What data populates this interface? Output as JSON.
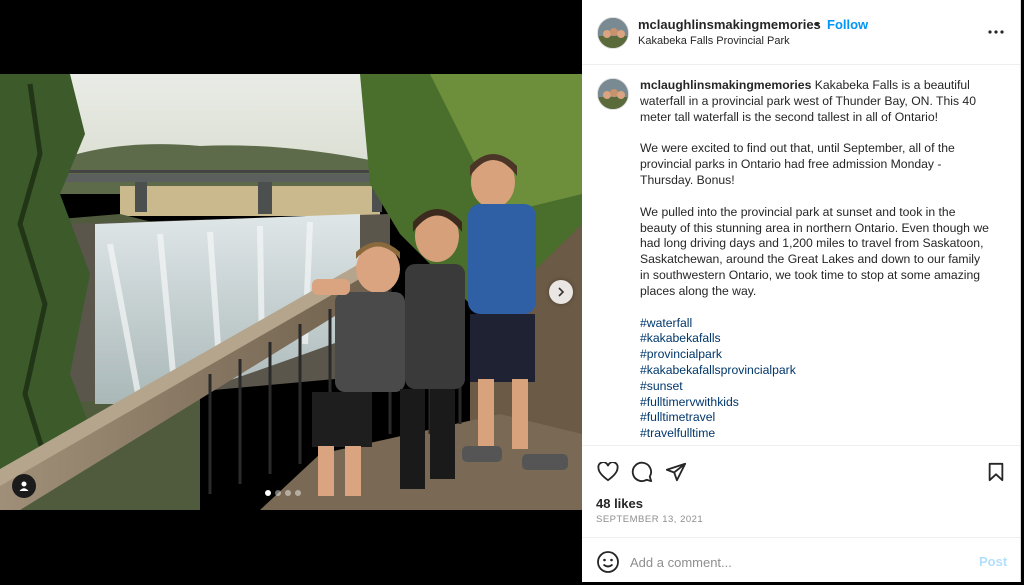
{
  "post": {
    "username": "mclaughlinsmakingmemories",
    "separator": "•",
    "follow_label": "Follow",
    "location": "Kakabeka Falls Provincial Park",
    "more_icon": "more-horizontal-icon"
  },
  "caption": {
    "username": "mclaughlinsmakingmemories",
    "intro": "Kakabeka Falls is a beautiful waterfall in a provincial park west of Thunder Bay, ON. This 40 meter tall waterfall is the second tallest in all of Ontario!",
    "paragraph2": "We were excited to find out that, until September, all of the provincial parks in Ontario had free admission Monday - Thursday. Bonus!",
    "paragraph3": "We pulled into the provincial park at sunset and took in the beauty of this stunning area in northern Ontario. Even though we had long driving days and 1,200 miles to travel from Saskatoon, Saskatchewan, around the Great Lakes and down to our family in southwestern Ontario, we took time to stop at some amazing places along the way.",
    "hashtags": [
      "#waterfall",
      "#kakabekafalls",
      "#provincialpark",
      "#kakabekafallsprovincialpark",
      "#sunset",
      "#fulltimervwithkids",
      "#fulltimetravel",
      "#travelfulltime"
    ]
  },
  "stats": {
    "likes": "48 likes",
    "date": "SEPTEMBER 13, 2021"
  },
  "comment": {
    "placeholder": "Add a comment...",
    "post_label": "Post"
  },
  "carousel": {
    "slide_count": 4,
    "active_index": 0
  },
  "colors": {
    "follow_blue": "#0095f6",
    "hashtag_blue": "#00376b",
    "post_disabled": "#b2dffc",
    "muted_text": "#8e8e8e"
  }
}
